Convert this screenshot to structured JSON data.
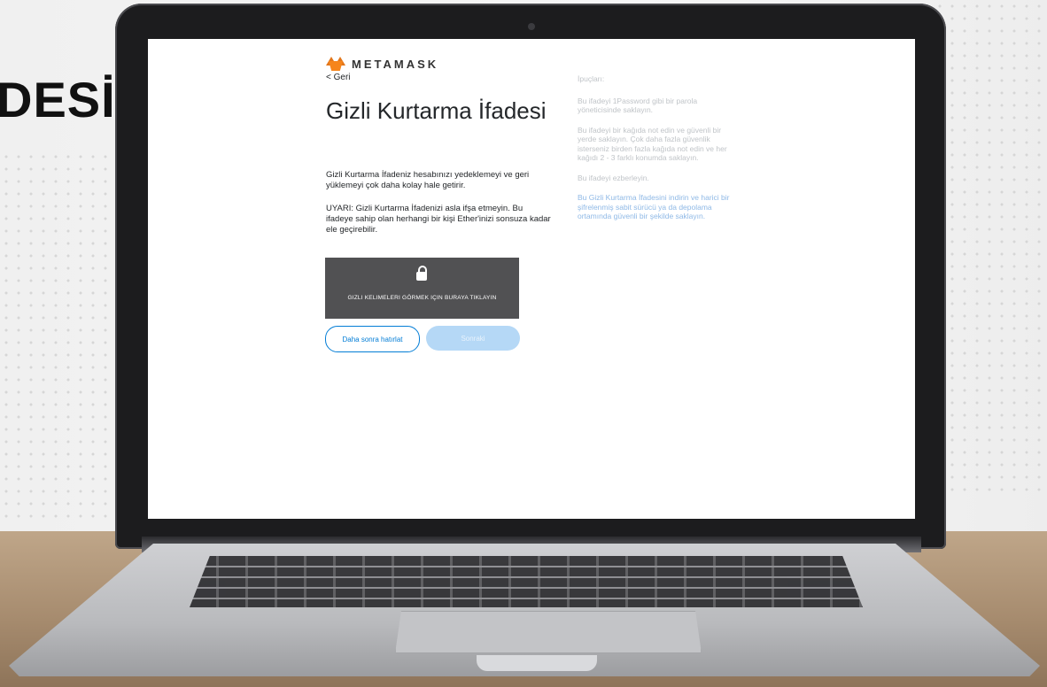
{
  "backdrop": {
    "headline": "DESİ"
  },
  "app": {
    "brand": "METAMASK"
  },
  "nav": {
    "back_label": "< Geri"
  },
  "main": {
    "title": "Gizli Kurtarma İfadesi",
    "description": "Gizli Kurtarma İfadeniz hesabınızı yedeklemeyi ve geri yüklemeyi çok daha kolay hale getirir.",
    "warning": "UYARI: Gizli Kurtarma İfadenizi asla ifşa etmeyin. Bu ifadeye sahip olan herhangi bir kişi Ether'inizi sonsuza kadar ele geçirebilir.",
    "reveal_label": "GIZLI KELIMELERI GÖRMEK IÇIN BURAYA TIKLAYIN",
    "remind_later_label": "Daha sonra hatırlat",
    "next_label": "Sonraki"
  },
  "tips": {
    "heading": "İpuçları:",
    "items": [
      "Bu ifadeyi 1Password gibi bir parola yöneticisinde saklayın.",
      "Bu ifadeyi bir kağıda not edin ve güvenli bir yerde saklayın. Çok daha fazla güvenlik isterseniz birden fazla kağıda not edin ve her kağıdı 2 - 3 farklı konumda saklayın.",
      "Bu ifadeyi ezberleyin."
    ],
    "download_link": "Bu Gizli Kurtarma İfadesini indirin ve harici bir şifrelenmiş sabit sürücü ya da depolama ortamında güvenli bir şekilde saklayın."
  },
  "colors": {
    "accent": "#037dd6",
    "reveal_bg": "#515153",
    "next_disabled": "#b5d8f6",
    "fox": "#f6851b"
  },
  "icons": {
    "logo": "metamask-fox-icon",
    "lock": "lock-icon"
  }
}
